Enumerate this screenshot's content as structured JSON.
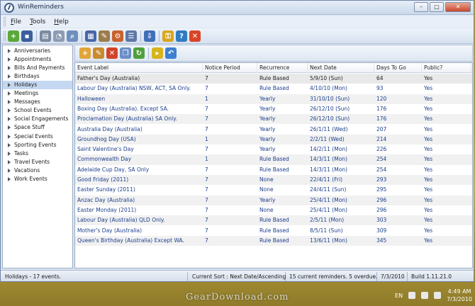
{
  "window": {
    "title": "WinReminders",
    "controls": {
      "minimize": "–",
      "maximize": "□",
      "close": "✕"
    }
  },
  "menu": [
    "File",
    "Tools",
    "Help"
  ],
  "toolbar": {
    "icons": [
      {
        "name": "new-reminder-icon",
        "color": "#5aa83a",
        "glyph": "+"
      },
      {
        "name": "save-icon",
        "color": "#3a5f9c",
        "glyph": "▪"
      },
      {
        "name": "print-icon",
        "color": "#7a8aa2",
        "glyph": "▤"
      },
      {
        "name": "print-preview-icon",
        "color": "#8e9bb4",
        "glyph": "◔"
      },
      {
        "name": "find-icon",
        "color": "#6f8fbf",
        "glyph": "⌕"
      },
      {
        "name": "calendar-icon",
        "color": "#4766a8",
        "glyph": "▦"
      },
      {
        "name": "edit-list-icon",
        "color": "#9b7d4a",
        "glyph": "✎"
      },
      {
        "name": "event-settings-icon",
        "color": "#c8622e",
        "glyph": "⚙"
      },
      {
        "name": "list-view-icon",
        "color": "#5d79a8",
        "glyph": "☰"
      },
      {
        "name": "import-icon",
        "color": "#3f6fb8",
        "glyph": "⇩"
      },
      {
        "name": "lock-icon",
        "color": "#d9a520",
        "glyph": "⚿"
      },
      {
        "name": "globe-help-icon",
        "color": "#2f7cc2",
        "glyph": "?"
      },
      {
        "name": "exit-icon",
        "color": "#d94428",
        "glyph": "✕"
      }
    ]
  },
  "sidebar": {
    "items": [
      {
        "label": "Anniversaries"
      },
      {
        "label": "Appointments"
      },
      {
        "label": "Bills And Payments"
      },
      {
        "label": "Birthdays"
      },
      {
        "label": "Holidays",
        "selected": true
      },
      {
        "label": "Meetings"
      },
      {
        "label": "Messages"
      },
      {
        "label": "School Events"
      },
      {
        "label": "Social Engagements"
      },
      {
        "label": "Space Stuff"
      },
      {
        "label": "Special Events"
      },
      {
        "label": "Sporting Events"
      },
      {
        "label": "Tasks"
      },
      {
        "label": "Travel Events"
      },
      {
        "label": "Vacations"
      },
      {
        "label": "Work Events"
      }
    ]
  },
  "event_toolbar": {
    "icons": [
      {
        "name": "add-event-icon",
        "color": "#e2a53a",
        "glyph": "+"
      },
      {
        "name": "edit-event-icon",
        "color": "#c98b2e",
        "glyph": "✎"
      },
      {
        "name": "delete-event-icon",
        "color": "#d2432a",
        "glyph": "✕"
      },
      {
        "name": "copy-event-icon",
        "color": "#6c8ec6",
        "glyph": "❐"
      },
      {
        "name": "refresh-icon",
        "color": "#4ea03c",
        "glyph": "↻"
      },
      {
        "name": "export-icon",
        "color": "#d8b31c",
        "glyph": "▸"
      },
      {
        "name": "undo-icon",
        "color": "#3d7fd0",
        "glyph": "↶"
      }
    ]
  },
  "table": {
    "columns": [
      "Event Label",
      "Notice Period",
      "Recurrence",
      "Next Date",
      "Days To Go",
      "Public?"
    ],
    "rows": [
      [
        "Father's Day (Australia)",
        "7",
        "Rule Based",
        "5/9/10 (Sun)",
        "64",
        "Yes"
      ],
      [
        "Labour Day (Australia) NSW, ACT, SA Only.",
        "7",
        "Rule Based",
        "4/10/10 (Mon)",
        "93",
        "Yes"
      ],
      [
        "Halloween",
        "1",
        "Yearly",
        "31/10/10 (Sun)",
        "120",
        "Yes"
      ],
      [
        "Boxing Day (Australia). Except SA.",
        "7",
        "Yearly",
        "26/12/10 (Sun)",
        "176",
        "Yes"
      ],
      [
        "Proclamation Day (Australia) SA Only.",
        "7",
        "Yearly",
        "26/12/10 (Sun)",
        "176",
        "Yes"
      ],
      [
        "Australia Day (Australia)",
        "7",
        "Yearly",
        "26/1/11 (Wed)",
        "207",
        "Yes"
      ],
      [
        "Groundhog Day (USA)",
        "1",
        "Yearly",
        "2/2/11 (Wed)",
        "214",
        "Yes"
      ],
      [
        "Saint Valentine's Day",
        "7",
        "Yearly",
        "14/2/11 (Mon)",
        "226",
        "Yes"
      ],
      [
        "Commonwealth Day",
        "1",
        "Rule Based",
        "14/3/11 (Mon)",
        "254",
        "Yes"
      ],
      [
        "Adelaide Cup Day, SA Only",
        "7",
        "Rule Based",
        "14/3/11 (Mon)",
        "254",
        "Yes"
      ],
      [
        "Good Friday (2011)",
        "7",
        "None",
        "22/4/11 (Fri)",
        "293",
        "Yes"
      ],
      [
        "Easter Sunday (2011)",
        "7",
        "None",
        "24/4/11 (Sun)",
        "295",
        "Yes"
      ],
      [
        "Anzac Day (Australia)",
        "7",
        "Yearly",
        "25/4/11 (Mon)",
        "296",
        "Yes"
      ],
      [
        "Easter Monday (2011)",
        "7",
        "None",
        "25/4/11 (Mon)",
        "296",
        "Yes"
      ],
      [
        "Labour Day (Australia) QLD Only.",
        "7",
        "Rule Based",
        "2/5/11 (Mon)",
        "303",
        "Yes"
      ],
      [
        "Mother's Day (Australia)",
        "7",
        "Rule Based",
        "8/5/11 (Sun)",
        "309",
        "Yes"
      ],
      [
        "Queen's Birthday (Australia) Except WA.",
        "7",
        "Rule Based",
        "13/6/11 (Mon)",
        "345",
        "Yes"
      ]
    ]
  },
  "status": {
    "category_count": "Holidays - 17 events.",
    "sort": "Current Sort : Next Date/Ascending",
    "reminders": "15 current reminders.  5 overdue.",
    "date": "7/3/2010",
    "build": "Build  1.11.21.0"
  },
  "taskbar": {
    "language": "EN",
    "time": "4:49 AM",
    "date": "7/3/2010"
  },
  "watermark": "GearDownload.com"
}
